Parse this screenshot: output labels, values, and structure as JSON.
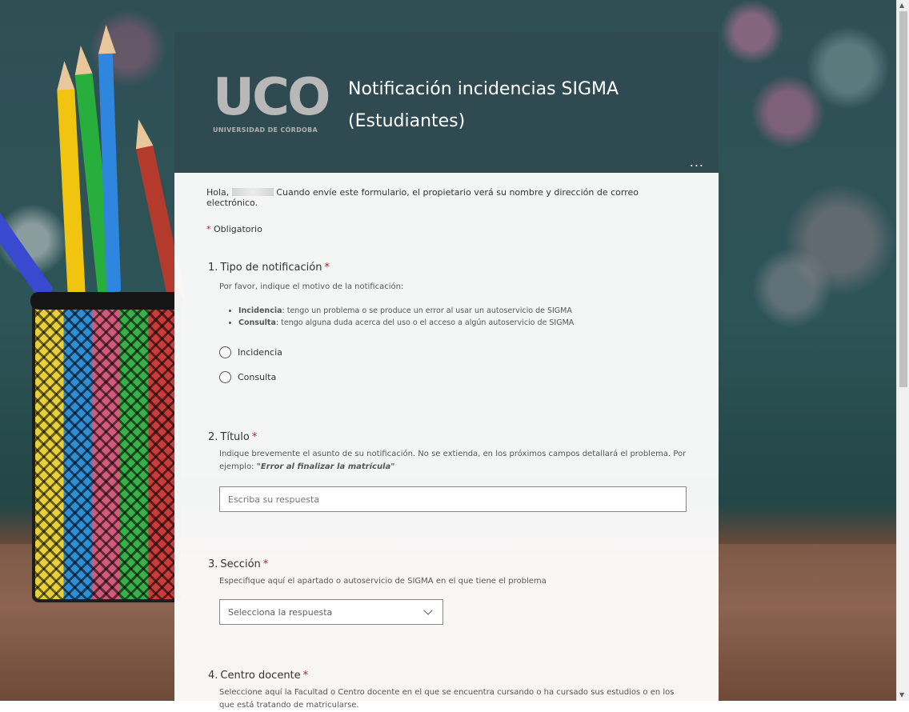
{
  "logo": {
    "letters": [
      "U",
      "C",
      "O"
    ],
    "subtitle": "UNIVERSIDAD DE CÓRDOBA"
  },
  "form": {
    "title": "Notificación incidencias SIGMA (Estudiantes)",
    "more_label": "...",
    "intro_greeting": "Hola,",
    "intro_text": "Cuando envíe este formulario, el propietario verá su nombre y dirección de correo electrónico.",
    "required_mark": "*",
    "required_note": "Obligatorio"
  },
  "questions": [
    {
      "number": "1.",
      "title": "Tipo de notificación",
      "description": "Por favor, indique el motivo de la notificación:",
      "bullets": [
        {
          "term": "Incidencia",
          "text": ": tengo un problema o se produce un error al usar un autoservicio de SIGMA"
        },
        {
          "term": "Consulta",
          "text": ": tengo alguna duda acerca del uso o el acceso a algún autoservicio de SIGMA"
        }
      ],
      "options": [
        "Incidencia",
        "Consulta"
      ]
    },
    {
      "number": "2.",
      "title": "Título",
      "description_prefix": "Indique brevemente el asunto de su notificación. No se extienda, en los próximos campos detallará el problema. Por ejemplo:",
      "description_example": "\"Error al finalizar la matrícula\"",
      "placeholder": "Escriba su respuesta"
    },
    {
      "number": "3.",
      "title": "Sección",
      "description": "Especifique aquí el apartado o autoservicio de SIGMA en el que tiene el problema",
      "select_placeholder": "Selecciona la respuesta"
    },
    {
      "number": "4.",
      "title": "Centro docente",
      "description": "Seleccione aquí la Facultad o Centro docente en el que se encuentra cursando o ha cursado sus estudios o en los que está tratando de matricularse."
    }
  ],
  "scrollbar": {
    "up_arrow": "▲",
    "down_arrow": "▼"
  },
  "colors": {
    "header_bg": "#2f4a50",
    "required": "#a4262c"
  }
}
